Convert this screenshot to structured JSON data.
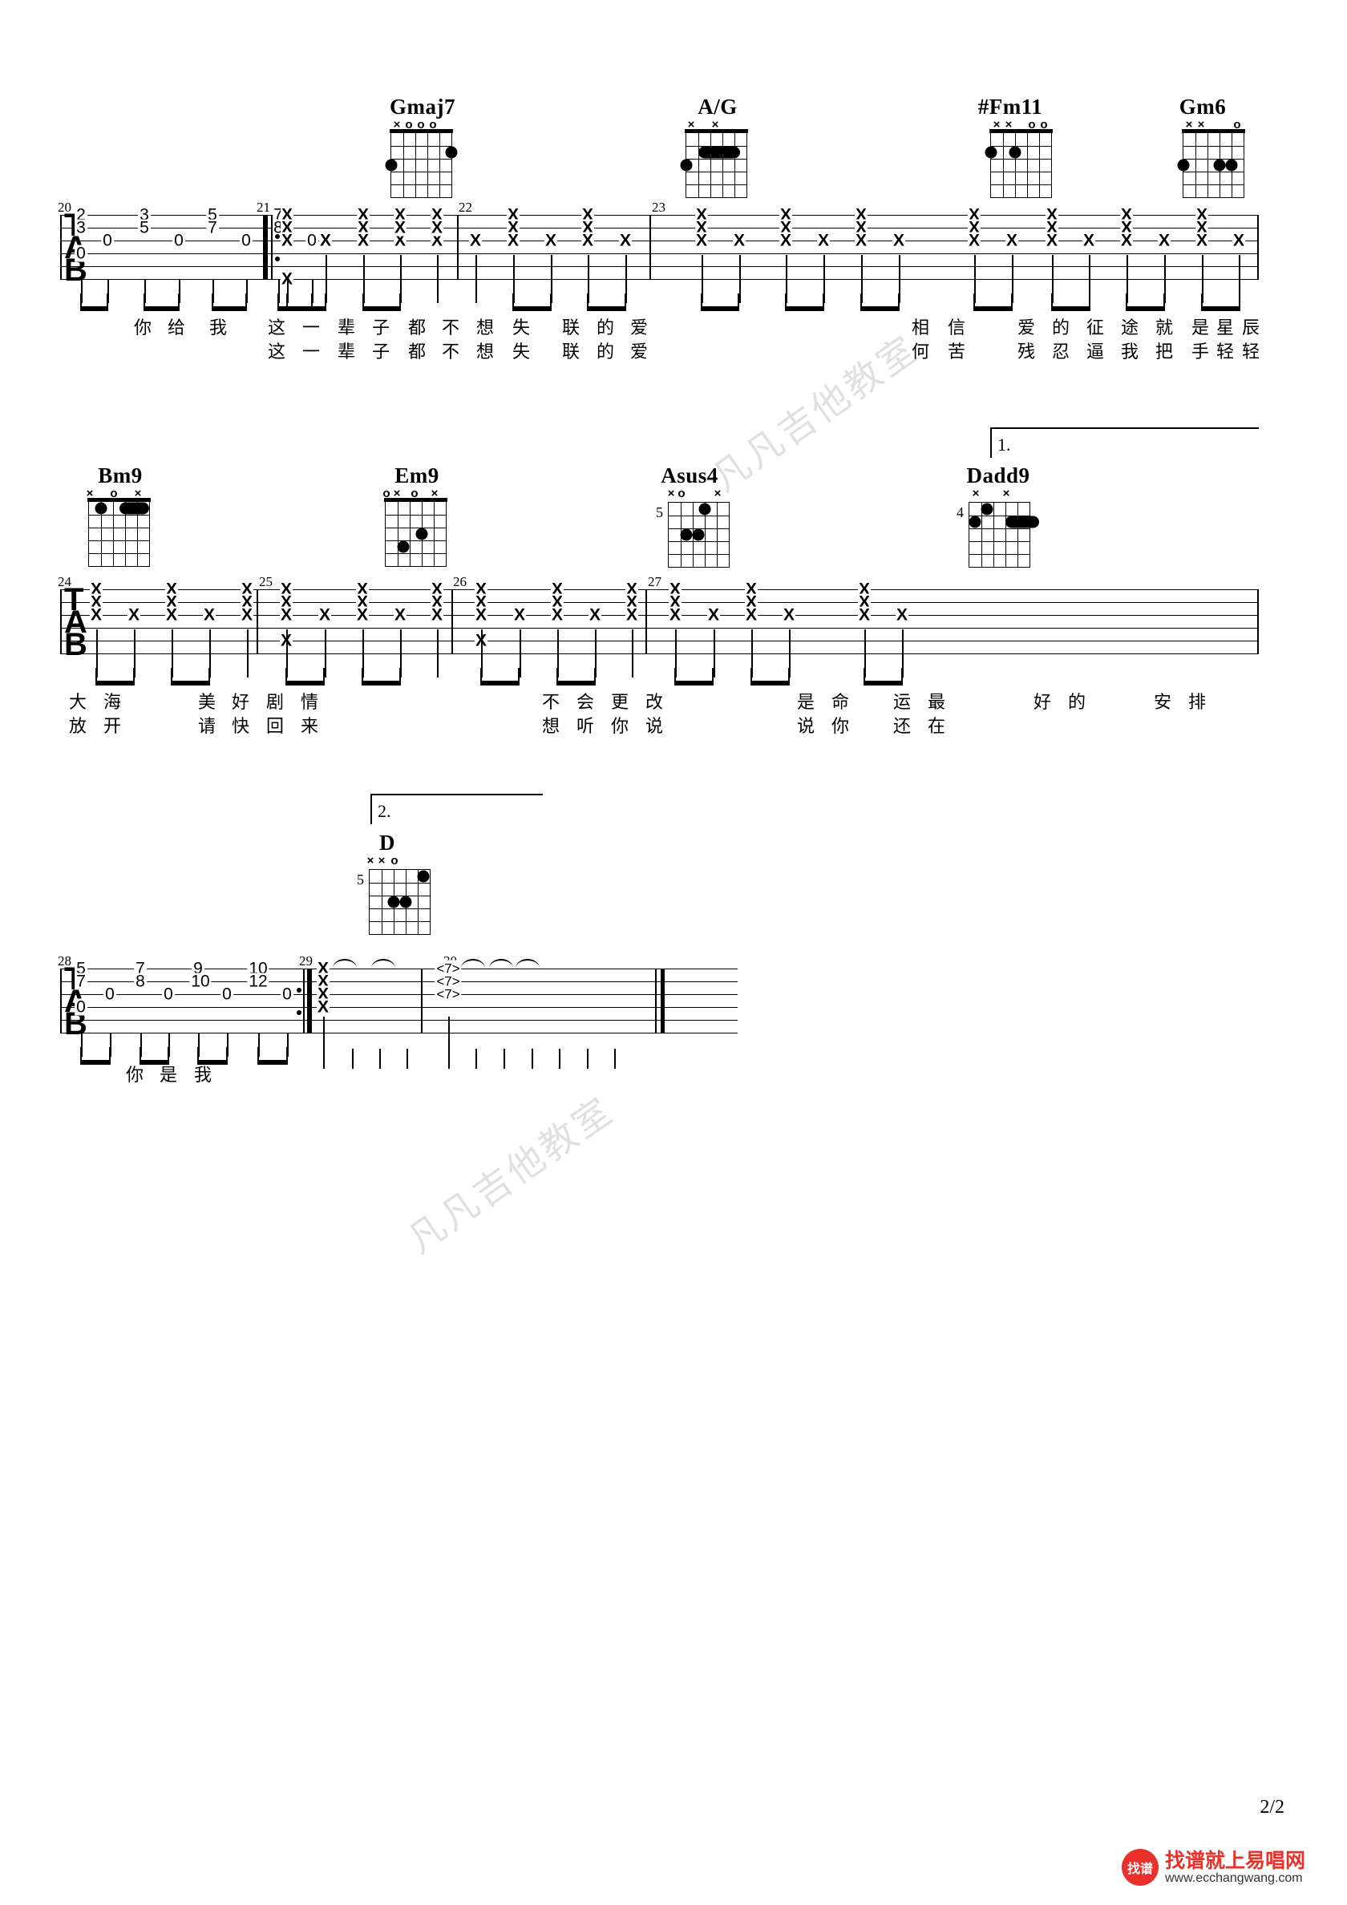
{
  "document": {
    "type": "guitar-tablature",
    "page_label": "2/2"
  },
  "watermarks": [
    {
      "text": "凡凡吉他教室"
    },
    {
      "text": "凡凡吉他教室"
    }
  ],
  "footer": {
    "logo_mark": "找谱",
    "brand_cn": "找谱就上易唱网",
    "brand_url": "www.ecchangwang.com"
  },
  "chords": [
    {
      "name": "Gmaj7",
      "open_marks": [
        "x",
        "o",
        "o",
        "o"
      ],
      "base_fret": "",
      "dots": "2 dots",
      "strings": 6,
      "frets": 5
    },
    {
      "name": "A/G",
      "open_marks": [
        "x",
        "x"
      ],
      "base_fret": "",
      "dots": "1 dot + barre",
      "strings": 6,
      "frets": 5
    },
    {
      "name": "#Fm11",
      "open_marks": [
        "x",
        "x",
        "o",
        "o"
      ],
      "base_fret": "",
      "dots": "2 dots",
      "strings": 6,
      "frets": 5
    },
    {
      "name": "Gm6",
      "open_marks": [
        "x",
        "x",
        "o"
      ],
      "base_fret": "",
      "dots": "3 dots",
      "strings": 6,
      "frets": 5
    },
    {
      "name": "Bm9",
      "open_marks": [
        "x",
        "o",
        "x"
      ],
      "base_fret": "",
      "dots": "1 dot + barre",
      "strings": 6,
      "frets": 5
    },
    {
      "name": "Em9",
      "open_marks": [
        "o",
        "x",
        "o",
        "x"
      ],
      "base_fret": "",
      "dots": "2 dots",
      "strings": 6,
      "frets": 5
    },
    {
      "name": "Asus4",
      "open_marks": [
        "x",
        "o",
        "x"
      ],
      "base_fret": "5",
      "dots": "3 dots",
      "strings": 6,
      "frets": 5
    },
    {
      "name": "Dadd9",
      "open_marks": [
        "x",
        "x"
      ],
      "base_fret": "4",
      "dots": "2 dots + barre",
      "strings": 6,
      "frets": 5
    },
    {
      "name": "D",
      "open_marks": [
        "x",
        "x",
        "o"
      ],
      "base_fret": "5",
      "dots": "3 dots",
      "strings": 6,
      "frets": 5
    }
  ],
  "systems": [
    {
      "id": "system-1",
      "clef": "TAB",
      "measures": [
        {
          "number": "20",
          "notes": [
            {
              "string": 1,
              "fret": "2"
            },
            {
              "string": 2,
              "fret": "3"
            },
            {
              "string": 4,
              "fret": "0"
            },
            {
              "string": 3,
              "fret": "0"
            },
            {
              "string": 1,
              "fret": "3"
            },
            {
              "string": 2,
              "fret": "5"
            },
            {
              "string": 3,
              "fret": "0"
            },
            {
              "string": 1,
              "fret": "5"
            },
            {
              "string": 2,
              "fret": "7"
            },
            {
              "string": 3,
              "fret": "0"
            },
            {
              "string": 1,
              "fret": "7"
            },
            {
              "string": 2,
              "fret": "8"
            },
            {
              "string": 3,
              "fret": "0"
            }
          ]
        },
        {
          "number": "21",
          "notes": [
            {
              "mute": "x"
            }
          ]
        },
        {
          "number": "22",
          "notes": [
            {
              "mute": "x"
            }
          ]
        },
        {
          "number": "23",
          "notes": [
            {
              "mute": "x"
            }
          ]
        }
      ],
      "lyrics_line_1": [
        "你",
        "给",
        "我",
        "这",
        "一",
        "辈",
        "子",
        "都",
        "不",
        "想",
        "失",
        "联",
        "的",
        "爱",
        "相",
        "信",
        "爱",
        "的",
        "征",
        "途",
        "就",
        "是",
        "星",
        "辰"
      ],
      "lyrics_line_2": [
        "这",
        "一",
        "辈",
        "子",
        "都",
        "不",
        "想",
        "失",
        "联",
        "的",
        "爱",
        "何",
        "苦",
        "残",
        "忍",
        "逼",
        "我",
        "把",
        "手",
        "轻",
        "轻"
      ]
    },
    {
      "id": "system-2",
      "clef": "TAB",
      "measures": [
        {
          "number": "24",
          "notes": [
            {
              "mute": "x"
            }
          ]
        },
        {
          "number": "25",
          "notes": [
            {
              "mute": "x"
            }
          ]
        },
        {
          "number": "26",
          "notes": [
            {
              "mute": "x"
            }
          ]
        },
        {
          "number": "27",
          "notes": [
            {
              "mute": "x"
            }
          ]
        }
      ],
      "volta": "1.",
      "lyrics_line_1": [
        "大",
        "海",
        "美",
        "好",
        "剧",
        "情",
        "不",
        "会",
        "更",
        "改",
        "是",
        "命",
        "运",
        "最",
        "好",
        "的",
        "安",
        "排"
      ],
      "lyrics_line_2": [
        "放",
        "开",
        "请",
        "快",
        "回",
        "来",
        "想",
        "听",
        "你",
        "说",
        "说",
        "你",
        "还",
        "在"
      ]
    },
    {
      "id": "system-3",
      "clef": "TAB",
      "measures": [
        {
          "number": "28",
          "notes": [
            {
              "string": 1,
              "fret": "5"
            },
            {
              "string": 2,
              "fret": "7"
            },
            {
              "string": 4,
              "fret": "0"
            },
            {
              "string": 3,
              "fret": "0"
            },
            {
              "string": 1,
              "fret": "7"
            },
            {
              "string": 2,
              "fret": "8"
            },
            {
              "string": 3,
              "fret": "0"
            },
            {
              "string": 1,
              "fret": "9"
            },
            {
              "string": 2,
              "fret": "10"
            },
            {
              "string": 3,
              "fret": "0"
            },
            {
              "string": 1,
              "fret": "10"
            },
            {
              "string": 2,
              "fret": "12"
            },
            {
              "string": 3,
              "fret": "0"
            }
          ]
        },
        {
          "number": "29",
          "notes": [
            {
              "mute": "x"
            }
          ]
        },
        {
          "number": "30",
          "notes": [
            {
              "harmonic": "<7>"
            }
          ]
        }
      ],
      "volta": "2.",
      "lyrics_line_1": [
        "你",
        "是",
        "我"
      ],
      "lyrics_line_2": []
    }
  ],
  "tab_labels": {
    "t": "T",
    "a": "A",
    "b": "B"
  },
  "measure_numbers": [
    "20",
    "21",
    "22",
    "23",
    "24",
    "25",
    "26",
    "27",
    "28",
    "29",
    "30"
  ],
  "harmonics": [
    "<7>",
    "<7>",
    "<7>"
  ],
  "fret_markers": {
    "asus4": "5",
    "dadd9": "4",
    "d": "5"
  }
}
